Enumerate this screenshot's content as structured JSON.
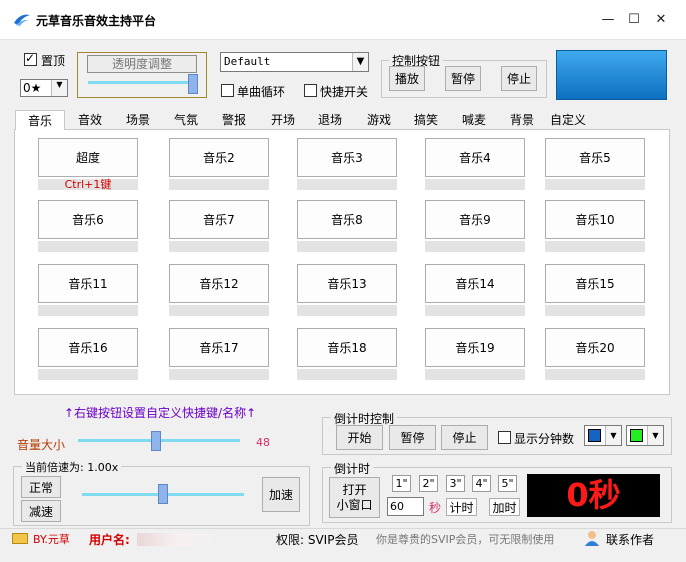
{
  "window": {
    "title": "元草音乐音效主持平台",
    "minimize_glyph": "—",
    "maximize_glyph": "☐",
    "close_glyph": "✕"
  },
  "top": {
    "pin_label": "置顶",
    "pin_checked": true,
    "star_select_value": "0★",
    "opacity_label": "透明度调整",
    "opacity_level": 0.95,
    "preset_select_value": "Default",
    "single_loop_label": "单曲循环",
    "hotkey_switch_label": "快捷开关",
    "control_group_title": "控制按钮",
    "play_label": "播放",
    "pause_label": "暂停",
    "stop_label": "停止"
  },
  "tabs": [
    {
      "label": "音乐",
      "active": true
    },
    {
      "label": "音效"
    },
    {
      "label": "场景"
    },
    {
      "label": "气氛"
    },
    {
      "label": "警报"
    },
    {
      "label": "开场"
    },
    {
      "label": "退场"
    },
    {
      "label": "游戏"
    },
    {
      "label": "搞笑"
    },
    {
      "label": "喊麦"
    },
    {
      "label": "背景"
    },
    {
      "label": "自定义"
    }
  ],
  "sound_buttons": [
    {
      "label": "超度",
      "hotkey": "Ctrl+1键"
    },
    {
      "label": "音乐2",
      "hotkey": ""
    },
    {
      "label": "音乐3",
      "hotkey": ""
    },
    {
      "label": "音乐4",
      "hotkey": ""
    },
    {
      "label": "音乐5",
      "hotkey": ""
    },
    {
      "label": "音乐6",
      "hotkey": ""
    },
    {
      "label": "音乐7",
      "hotkey": ""
    },
    {
      "label": "音乐8",
      "hotkey": ""
    },
    {
      "label": "音乐9",
      "hotkey": ""
    },
    {
      "label": "音乐10",
      "hotkey": ""
    },
    {
      "label": "音乐11",
      "hotkey": ""
    },
    {
      "label": "音乐12",
      "hotkey": ""
    },
    {
      "label": "音乐13",
      "hotkey": ""
    },
    {
      "label": "音乐14",
      "hotkey": ""
    },
    {
      "label": "音乐15",
      "hotkey": ""
    },
    {
      "label": "音乐16",
      "hotkey": ""
    },
    {
      "label": "音乐17",
      "hotkey": ""
    },
    {
      "label": "音乐18",
      "hotkey": ""
    },
    {
      "label": "音乐19",
      "hotkey": ""
    },
    {
      "label": "音乐20",
      "hotkey": ""
    }
  ],
  "hint": "↑右键按钮设置自定义快捷键/名称↑",
  "volume": {
    "label": "音量大小",
    "value": "48",
    "level": 0.48
  },
  "speed": {
    "label": "当前倍速为: 1.00x",
    "normal_label": "正常",
    "slow_label": "减速",
    "fast_label": "加速",
    "level": 0.5
  },
  "countdown_control": {
    "title": "倒计时控制",
    "start_label": "开始",
    "pause_label": "暂停",
    "stop_label": "停止",
    "show_minutes_label": "显示分钟数",
    "show_minutes_checked": false,
    "color1": "#1565c0",
    "color2": "#22ee22"
  },
  "countdown": {
    "title": "倒计时",
    "open_label": "打开",
    "mini_window_label": "小窗口",
    "presets": [
      "1\"",
      "2\"",
      "3\"",
      "4\"",
      "5\""
    ],
    "seconds_value": "60",
    "seconds_unit": "秒",
    "timer_label": "计时",
    "add_time_label": "加时",
    "display": "0秒"
  },
  "status": {
    "by_label": "BY.元草",
    "user_label": "用户名:",
    "permission": "权限: SVIP会员",
    "notice": "你是尊贵的SVIP会员，可无限制使用",
    "contact_label": "联系作者"
  },
  "colors": {
    "accent_blue": "#1a8cd8",
    "hint_purple": "#6b00c8",
    "volume_red": "#b43c00",
    "display_red": "#ff1a1a"
  }
}
